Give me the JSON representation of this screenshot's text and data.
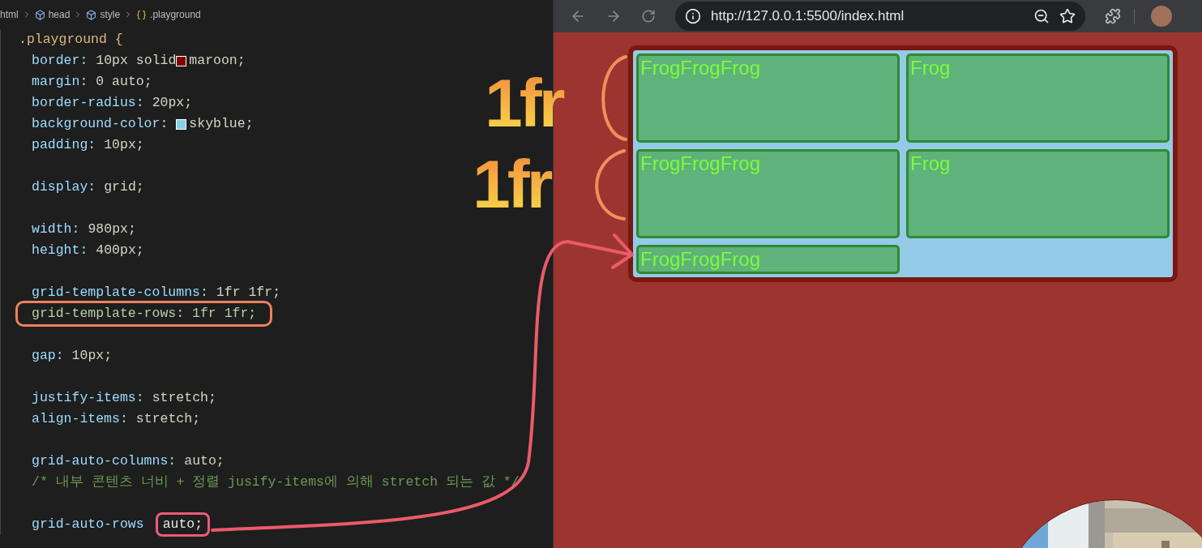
{
  "editor": {
    "breadcrumbs": [
      {
        "label": "html"
      },
      {
        "label": "head"
      },
      {
        "label": "style"
      },
      {
        "label": ".playground"
      }
    ],
    "lines": [
      {
        "kind": "selector",
        "text": ".playground {"
      },
      {
        "kind": "decl",
        "prop": "border:",
        "value": [
          {
            "text": "10px solid "
          },
          {
            "kind": "swatch",
            "color": "#800000"
          },
          {
            "text": "maroon;"
          }
        ]
      },
      {
        "kind": "decl",
        "prop": "margin:",
        "value": [
          {
            "text": "0 auto;"
          }
        ]
      },
      {
        "kind": "decl",
        "prop": "border-radius:",
        "value": [
          {
            "text": "20px;"
          }
        ]
      },
      {
        "kind": "decl",
        "prop": "background-color:",
        "value": [
          {
            "kind": "swatch",
            "color": "#87ceeb"
          },
          {
            "text": "skyblue;"
          }
        ]
      },
      {
        "kind": "decl",
        "prop": "padding:",
        "value": [
          {
            "text": "10px;"
          }
        ]
      },
      {
        "kind": "blank"
      },
      {
        "kind": "decl",
        "prop": "display:",
        "value": [
          {
            "text": "grid;"
          }
        ]
      },
      {
        "kind": "blank"
      },
      {
        "kind": "decl",
        "prop": "width:",
        "value": [
          {
            "text": "980px;"
          }
        ]
      },
      {
        "kind": "decl",
        "prop": "height:",
        "value": [
          {
            "text": "400px;"
          }
        ]
      },
      {
        "kind": "blank"
      },
      {
        "kind": "decl",
        "prop": "grid-template-columns:",
        "value": [
          {
            "text": "1fr 1fr;"
          }
        ]
      },
      {
        "kind": "decl",
        "prop": "grid-template-rows:",
        "value": [
          {
            "text": "1fr 1fr;"
          }
        ],
        "boxed": true,
        "color": "#f0805a"
      },
      {
        "kind": "blank"
      },
      {
        "kind": "decl",
        "prop": "gap:",
        "value": [
          {
            "text": "10px;"
          }
        ]
      },
      {
        "kind": "blank"
      },
      {
        "kind": "decl",
        "prop": "justify-items:",
        "value": [
          {
            "text": "stretch;"
          }
        ]
      },
      {
        "kind": "decl",
        "prop": "align-items:",
        "value": [
          {
            "text": "stretch;"
          }
        ]
      },
      {
        "kind": "blank"
      },
      {
        "kind": "decl",
        "prop": "grid-auto-columns:",
        "value": [
          {
            "text": "auto;"
          }
        ]
      },
      {
        "kind": "comment",
        "text": "/* 내부 콘텐츠 너비 + 정렬 jusify-items에 의해 stretch 되는 값 */"
      },
      {
        "kind": "blank"
      },
      {
        "kind": "decl",
        "prop": "grid-auto-rows",
        "value": [
          {
            "text": "auto;",
            "boxed": true,
            "color": "#ec5a7a"
          }
        ]
      }
    ]
  },
  "browser": {
    "url": "http://127.0.0.1:5500/index.html",
    "grid_items": [
      "FrogFrogFrog",
      "Frog",
      "FrogFrogFrog",
      "Frog",
      "FrogFrogFrog"
    ]
  },
  "annotations": [
    {
      "text": "1fr"
    },
    {
      "text": "1fr"
    }
  ]
}
